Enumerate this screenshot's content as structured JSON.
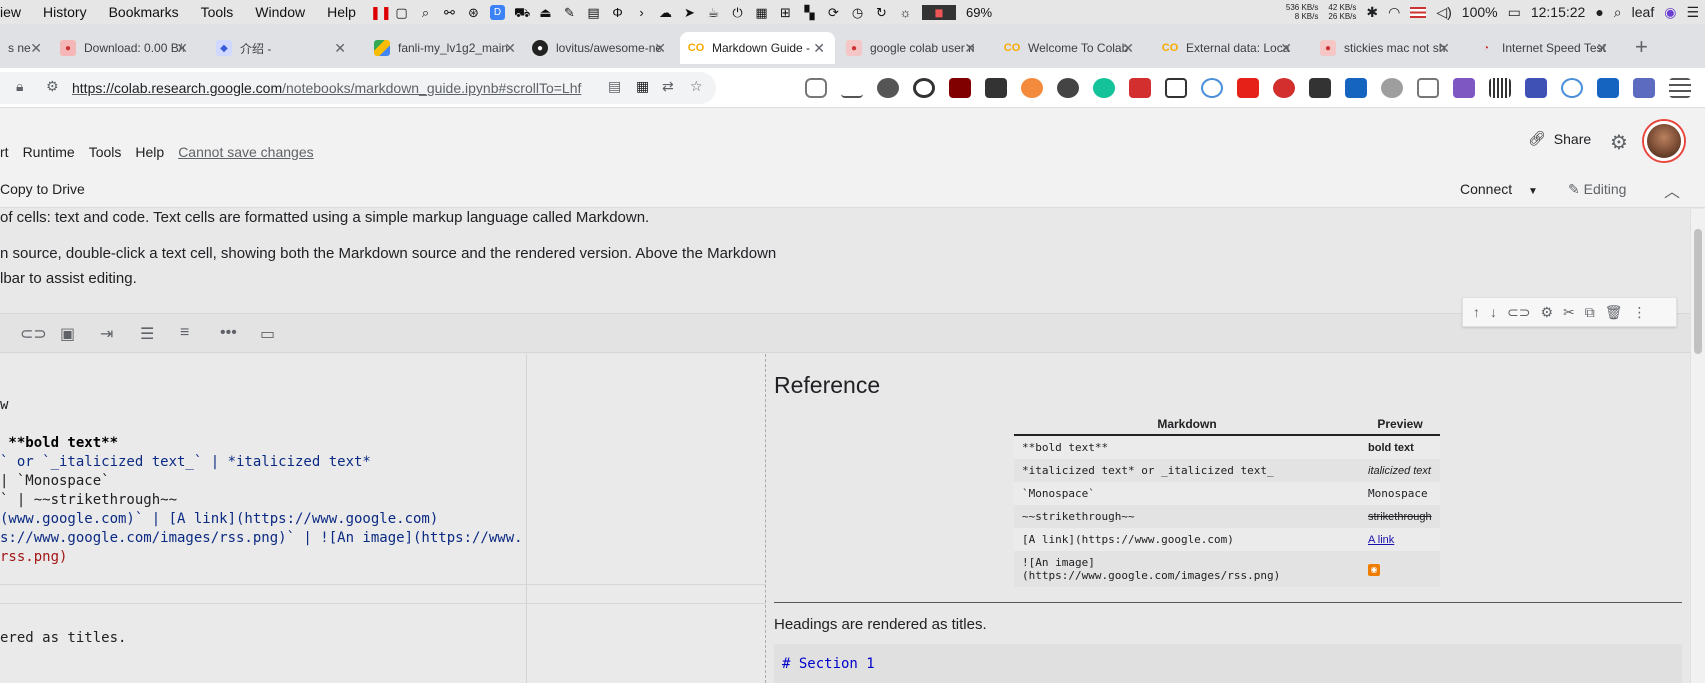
{
  "os_menu": [
    "iew",
    "History",
    "Bookmarks",
    "Tools",
    "Window",
    "Help"
  ],
  "status": {
    "battery_pct_icon": "69%",
    "net_up": "536 KB/s",
    "net_down": "8 KB/s",
    "net2_up": "42 KB/s",
    "net2_down": "26 KB/s",
    "battery": "100%",
    "time": "12:15:22",
    "user": "leaf"
  },
  "tabs": [
    {
      "title": "s ne",
      "icon": "globe-icon"
    },
    {
      "title": "Download: 0.00 B/s",
      "icon": "download-icon"
    },
    {
      "title": "介绍 -",
      "icon": "doc-icon"
    },
    {
      "title": "fanli-my_lv1g2_main",
      "icon": "drive-icon"
    },
    {
      "title": "lovitus/awesome-ne",
      "icon": "github-icon"
    },
    {
      "title": "Markdown Guide - ",
      "icon": "colab-icon"
    },
    {
      "title": "google colab user m",
      "icon": "google-icon"
    },
    {
      "title": "Welcome To Colab",
      "icon": "colab-icon"
    },
    {
      "title": "External data: Local",
      "icon": "colab-icon"
    },
    {
      "title": "stickies mac not sh",
      "icon": "google-icon"
    },
    {
      "title": "Internet Speed Test",
      "icon": "speed-icon"
    }
  ],
  "address": {
    "url_host": "https://colab.research.google.com",
    "url_path": "/notebooks/markdown_guide.ipynb#scrollTo=Lhf"
  },
  "colab": {
    "menu": [
      "rt",
      "Runtime",
      "Tools",
      "Help"
    ],
    "cannot_save": "Cannot save changes",
    "share": "Share",
    "copy_drive": "Copy to Drive",
    "connect": "Connect",
    "editing": "Editing"
  },
  "content": {
    "p1": "of cells: text and code. Text cells are formatted using a simple markup language called Markdown.",
    "p2a": "n source, double-click a text cell, showing both the Markdown source and the rendered version. Above the Markdown",
    "p2b": "lbar to assist editing."
  },
  "editor": {
    "lines": [
      {
        "pre": "w",
        "parts": []
      },
      {
        "pre": "",
        "parts": []
      },
      {
        "pre": " **bold text**",
        "parts": []
      },
      {
        "pre": "` or `_italicized text_` | *italicized text*",
        "parts": []
      },
      {
        "pre": "| `Monospace`",
        "parts": []
      },
      {
        "pre": "` | ~~strikethrough~~",
        "parts": []
      },
      {
        "pre": "(www.google.com)` | [A link](https://www.google.com)",
        "parts": []
      },
      {
        "pre": "s://www.google.com/images/rss.png)` | ![An image](https://www.",
        "parts": []
      },
      {
        "pre": "rss.png)",
        "parts": []
      }
    ],
    "line_after": "ered as titles."
  },
  "preview": {
    "heading": "Reference",
    "th_markdown": "Markdown",
    "th_preview": "Preview",
    "rows": [
      {
        "src": "**bold text**",
        "out": "bold text"
      },
      {
        "src": "*italicized text* or _italicized text_",
        "out": "italicized text"
      },
      {
        "src": "`Monospace`",
        "out": "Monospace"
      },
      {
        "src": "~~strikethrough~~",
        "out": "strikethrough"
      },
      {
        "src": "[A link](https://www.google.com)",
        "out": "A link"
      },
      {
        "src": "![An image](https://www.google.com/images/rss.png)",
        "out": ""
      }
    ],
    "headings_text": "Headings are rendered as titles.",
    "code": "# Section 1"
  }
}
